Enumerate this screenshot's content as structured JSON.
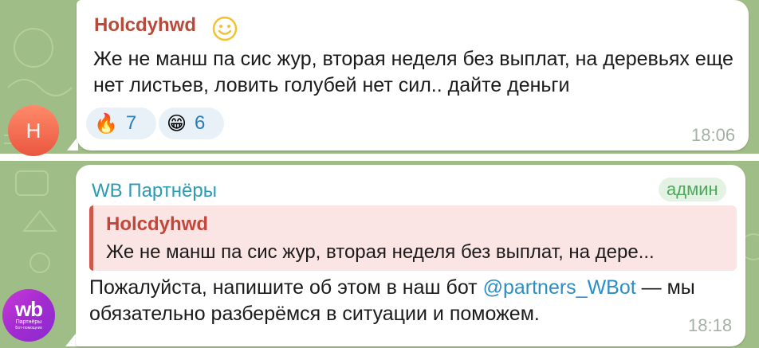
{
  "messages": [
    {
      "sender": "Holcdyhwd",
      "avatar_letter": "Н",
      "text": "Же не манш па сис жур, вторая неделя без выплат, на деревьях еще нет листьев, ловить голубей нет сил.. дайте деньги",
      "reactions": [
        {
          "icon": "fire-emoji",
          "glyph": "🔥",
          "count": "7"
        },
        {
          "icon": "grin-emoji",
          "glyph": "😁",
          "count": "6"
        }
      ],
      "time": "18:06"
    },
    {
      "sender": "WB Партнёры",
      "badge": "админ",
      "avatar": {
        "logo": "wb",
        "subtitle": "Партнёры",
        "subtitle2": "Бот-помощник"
      },
      "reply": {
        "author": "Holcdyhwd",
        "text": "Же не манш па сис жур, вторая неделя без выплат, на дере..."
      },
      "text_before_link": "Пожалуйста, напишите об этом в наш бот ",
      "link": "@partners_WBot",
      "text_after_link": " — мы обязательно разберёмся в ситуации и поможем.",
      "time": "18:18"
    }
  ],
  "colors": {
    "background": "#9fbd86",
    "sender1": "#b64b3b",
    "sender2": "#2d9bb4",
    "link": "#2d8ec4",
    "badge": "#4aa85a"
  }
}
